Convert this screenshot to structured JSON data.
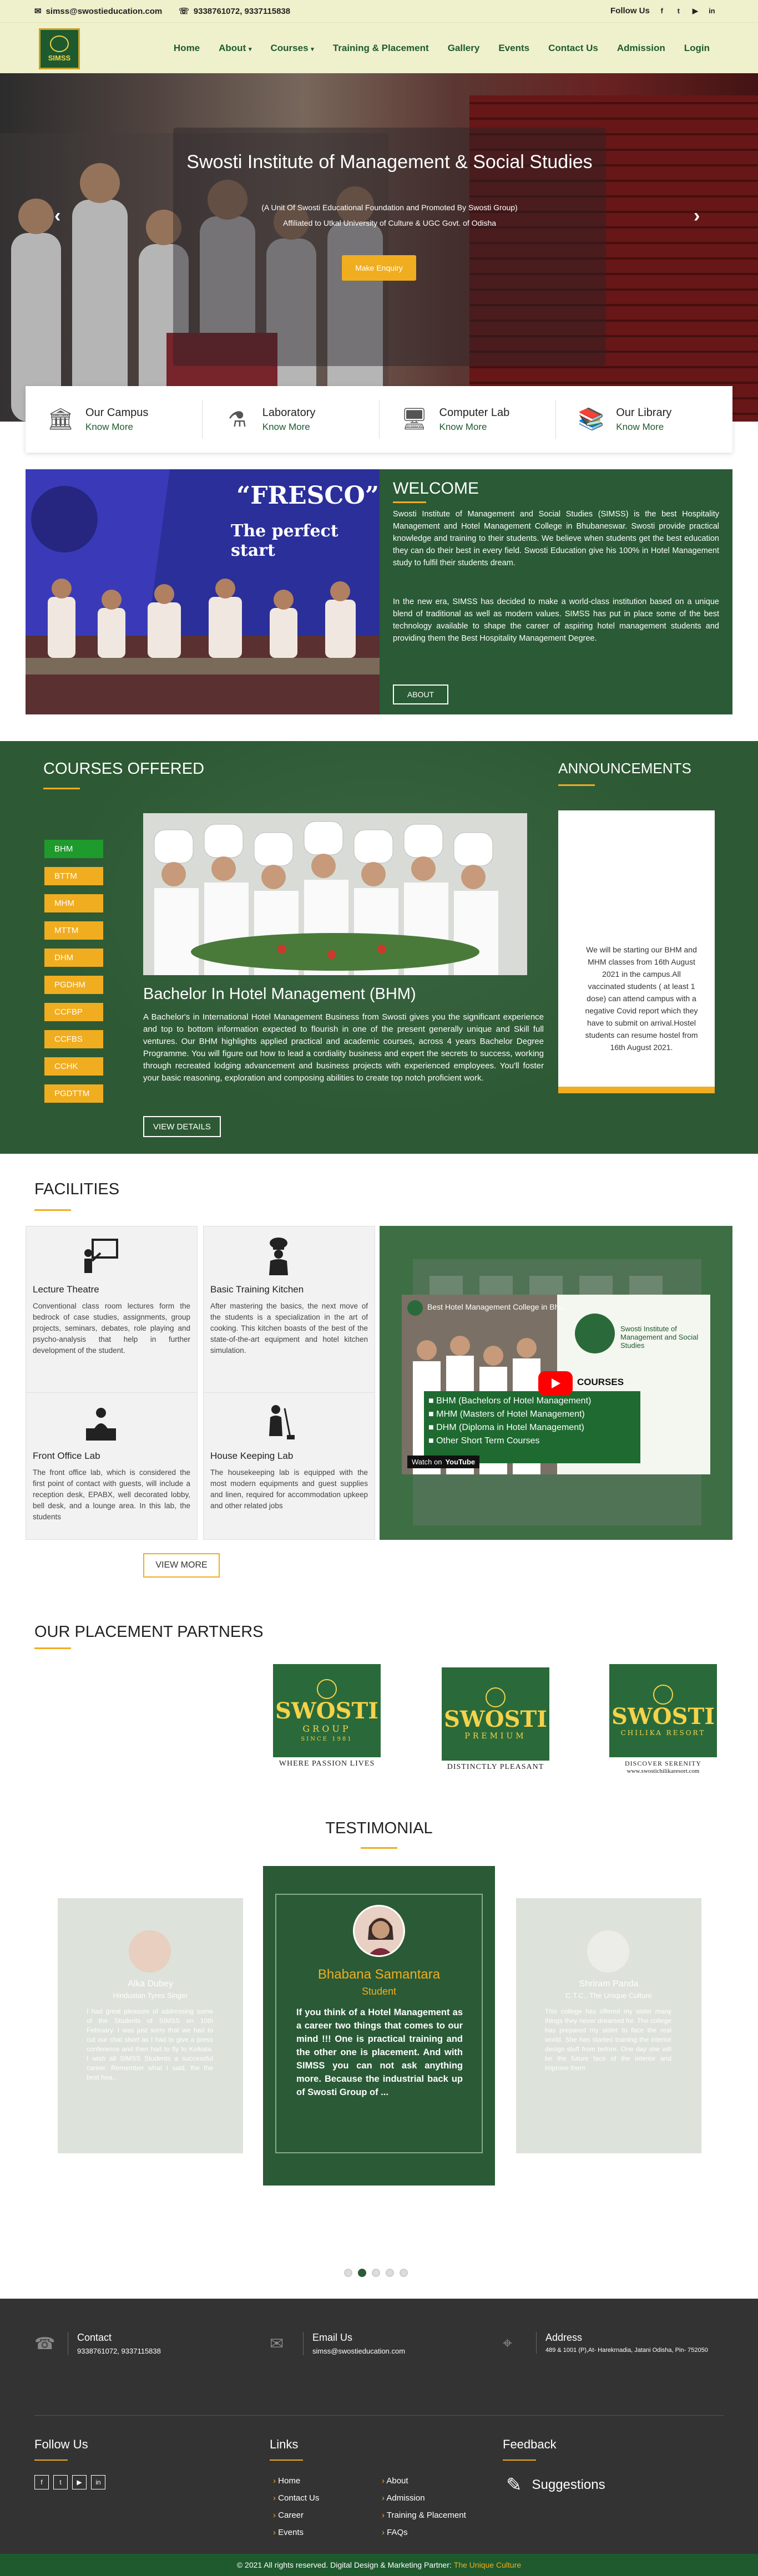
{
  "topbar": {
    "email": "simss@swostieducation.com",
    "phone": "9338761072, 9337115838",
    "follow_label": "Follow Us",
    "socials": [
      "f",
      "t",
      "▶",
      "in"
    ]
  },
  "nav": {
    "logo_text": "SIMSS",
    "items": [
      "Home",
      "About",
      "Courses",
      "Training & Placement",
      "Gallery",
      "Events",
      "Contact Us",
      "Admission",
      "Login"
    ]
  },
  "hero": {
    "title": "Swosti Institute of Management & Social Studies",
    "subtitle": "(A Unit Of Swosti Educational Foundation and Promoted By Swosti Group)",
    "affiliation": "Affiliated to Utkal University of Culture & UGC Govt. of Odisha",
    "button": "Make Enquiry",
    "prev": "‹",
    "next": "›"
  },
  "quick_links": [
    {
      "title": "Our Campus",
      "sub": "Know More",
      "icon": "campus-icon"
    },
    {
      "title": "Laboratory",
      "sub": "Know More",
      "icon": "lab-icon"
    },
    {
      "title": "Computer Lab",
      "sub": "Know More",
      "icon": "computer-icon"
    },
    {
      "title": "Our Library",
      "sub": "Know More",
      "icon": "library-icon"
    }
  ],
  "welcome": {
    "banner_text": "“FRESCO”",
    "banner_sub": "The perfect start",
    "title": "WELCOME",
    "p1": "Swosti Institute of Management and Social Studies (SIMSS) is the best Hospitality Management and Hotel Management College in Bhubaneswar. Swosti provide practical knowledge and training to their students. We believe when students get the best education they can do their best in every field. Swosti Education give his 100% in Hotel Management study to fulfil their students dream.",
    "p2": "In the new era, SIMSS has decided to make a world-class institution based on a unique blend of traditional as well as modern values. SIMSS has put in place some of the best technology available to shape the career of aspiring hotel management students and providing them the Best Hospitality Management Degree.",
    "button": "ABOUT"
  },
  "courses": {
    "title": "COURSES OFFERED",
    "list": [
      "BHM",
      "BTTM",
      "MHM",
      "MTTM",
      "DHM",
      "PGDHM",
      "CCFBP",
      "CCFBS",
      "CCHK",
      "PGDTTM"
    ],
    "active_title": "Bachelor In Hotel Management (BHM)",
    "description": "A Bachelor's in International Hotel Management Business from Swosti gives you the significant experience and top to bottom information expected to flourish in one of the present generally unique and Skill full ventures. Our BHM highlights applied practical and academic courses, across 4 years Bachelor Degree Programme. You will figure out how to lead a cordiality business and expert the secrets to success, working through recreated lodging advancement and business projects with experienced employees. You'll foster your basic reasoning, exploration and composing abilities to create top notch proficient work.",
    "button": "VIEW DETAILS"
  },
  "announcements": {
    "title": "ANNOUNCEMENTS",
    "text": "We will be starting our BHM and MHM classes from 16th August 2021 in the campus.All vaccinated students ( at least 1 dose) can attend campus with a negative Covid report which they have to submit on arrival.Hostel students can resume hostel from 16th August 2021."
  },
  "facilities": {
    "title": "FACILITIES",
    "cards": [
      {
        "title": "Lecture Theatre",
        "icon": "lecture-icon",
        "text": "Conventional class room lectures form the bedrock of case studies, assignments, group projects, seminars, debates, role playing and psycho-analysis that help in further development of the student."
      },
      {
        "title": "Basic Training Kitchen",
        "icon": "chef-icon",
        "text": "After mastering the basics, the next move of the students is a specialization in the art of cooking. This kitchen boasts of the best of the state-of-the-art equipment and hotel kitchen simulation."
      },
      {
        "title": "Front Office Lab",
        "icon": "front-office-icon",
        "text": "The front office lab, which is considered the first point of contact with guests, will include a reception desk, EPABX, well decorated lobby, bell desk, and a lounge area. In this lab, the students"
      },
      {
        "title": "House Keeping Lab",
        "icon": "housekeeping-icon",
        "text": "The housekeeping lab is equipped with the most modern equipments and guest supplies and linen, required for accommodation upkeep and other related jobs"
      }
    ],
    "video_title": "Best Hotel Management College in Bhu...",
    "video_brand": "Swosti Institute of Management and Social Studies",
    "video_courses_label": "COURSES",
    "video_courses": [
      "BHM (Bachelors of Hotel Management)",
      "MHM (Masters of Hotel Management)",
      "DHM (Diploma in Hotel Management)",
      "Other Short Term Courses"
    ],
    "video_watch": "Watch on",
    "video_yt": "YouTube",
    "button": "VIEW MORE"
  },
  "partners": {
    "title": "OUR PLACEMENT PARTNERS",
    "logos": [
      {
        "name": "SWOSTI",
        "tag": "GROUP",
        "since": "SINCE 1981",
        "caption": "WHERE PASSION LIVES"
      },
      {
        "name": "SWOSTI",
        "tag": "PREMIUM",
        "since": "",
        "caption": "DISTINCTLY PLEASANT"
      },
      {
        "name": "SWOSTI",
        "tag": "CHILIKA RESORT",
        "since": "",
        "caption": "DISCOVER SERENITY"
      }
    ],
    "url": "www.swostichilikaresort.com"
  },
  "testimonials": {
    "title": "TESTIMONIAL",
    "items": [
      {
        "name": "Alka Dubey",
        "role": "Hindustan Tyres Singer",
        "text": "I had great pleasure of addressing some of the Students of SIMSS on 10th February. I was just sorry that we had to cut our chat short as I had to give a press conference and then had to fly to Kolkata. I wish all SIMSS Students a successful career. Remember what I said, the the best hea..."
      },
      {
        "name": "Bhabana Samantara",
        "role": "Student",
        "text": "If you think of a Hotel Management as a career two things that comes to our mind !!! One is practical training and the other one is placement. And with SIMSS you can not ask anything more. Because the industrial back up of Swosti Group of ..."
      },
      {
        "name": "Shriram Panda",
        "role": "C.T.C., The Unique Culture",
        "text": "This college has offered my sister many things they never dreamed for. The college has prepared my sister to face the real world. She has started training the interior design stuff from before. One day she will be the future face of the interior and improve them"
      }
    ],
    "dots": 5,
    "active_dot": 1
  },
  "footer": {
    "contact_label": "Contact",
    "contact_value": "9338761072, 9337115838",
    "email_label": "Email Us",
    "email_value": "simss@swostieducation.com",
    "address_label": "Address",
    "address_value": "489 & 1001 (P),At- Harekrnadia, Jatani Odisha, Pin- 752050",
    "follow_title": "Follow Us",
    "links_title": "Links",
    "links_col1": [
      "Home",
      "Contact Us",
      "Career",
      "Events"
    ],
    "links_col2": [
      "About",
      "Admission",
      "Training & Placement",
      "FAQs"
    ],
    "feedback_title": "Feedback",
    "suggestions": "Suggestions",
    "copyright": "© 2021 All rights reserved. Digital Design & Marketing Partner:",
    "partner": "The Unique Culture"
  },
  "colors": {
    "primary_green": "#2a5a36",
    "accent_orange": "#f0ad20",
    "topbar_cream": "#eff0cc",
    "footer_dark": "#333333"
  }
}
